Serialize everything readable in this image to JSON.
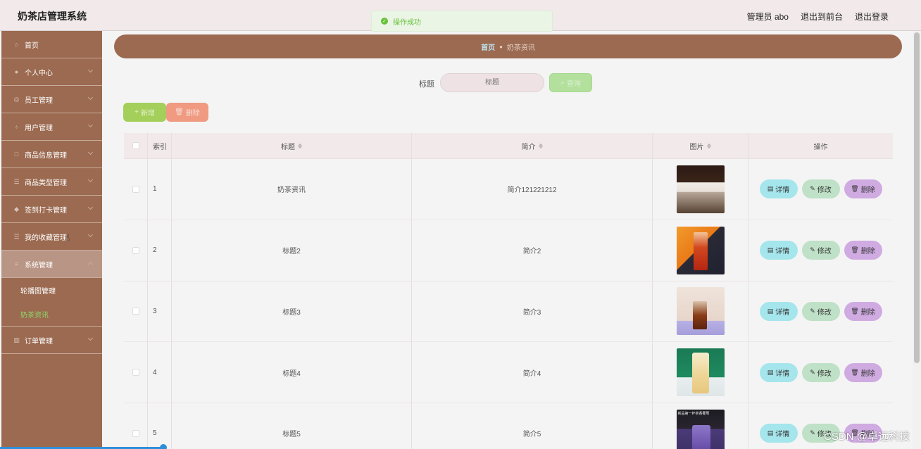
{
  "header": {
    "brand": "奶茶店管理系统",
    "user_label": "管理员 abo",
    "front_link": "退出到前台",
    "logout": "退出登录"
  },
  "toast": {
    "icon": "check-circle-icon",
    "text": "操作成功"
  },
  "sidebar": {
    "items": [
      {
        "label": "首页",
        "icon": "home-icon"
      },
      {
        "label": "个人中心",
        "icon": "user-icon"
      },
      {
        "label": "员工管理",
        "icon": "globe-icon"
      },
      {
        "label": "用户管理",
        "icon": "location-icon"
      },
      {
        "label": "商品信息管理",
        "icon": "box-icon"
      },
      {
        "label": "商品类型管理",
        "icon": "list-icon"
      },
      {
        "label": "签到打卡管理",
        "icon": "shield-icon"
      },
      {
        "label": "我的收藏管理",
        "icon": "list-icon"
      },
      {
        "label": "系统管理",
        "icon": "sliders-icon"
      },
      {
        "label": "订单管理",
        "icon": "chart-icon"
      }
    ],
    "sub_items": [
      {
        "label": "轮播图管理"
      },
      {
        "label": "奶茶资讯"
      }
    ]
  },
  "breadcrumb": {
    "home": "首页",
    "current": "奶茶资讯"
  },
  "search": {
    "label": "标题",
    "placeholder": "标题",
    "button": "查询"
  },
  "actions": {
    "add": "新增",
    "delete": "删除"
  },
  "table": {
    "headers": {
      "index": "索引",
      "title": "标题",
      "intro": "简介",
      "image": "图片",
      "ops": "操作"
    },
    "rows": [
      {
        "index": "1",
        "title": "奶茶资讯",
        "intro": "简介121221212"
      },
      {
        "index": "2",
        "title": "标题2",
        "intro": "简介2"
      },
      {
        "index": "3",
        "title": "标题3",
        "intro": "简介3"
      },
      {
        "index": "4",
        "title": "标题4",
        "intro": "简介4"
      },
      {
        "index": "5",
        "title": "标题5",
        "intro": "简介5"
      }
    ],
    "row_buttons": {
      "detail": "详情",
      "edit": "修改",
      "remove": "删除"
    },
    "thumb5_caption": "新品第一杯茶香葡萄"
  },
  "watermark": "CSDN @卓远科技",
  "colors": {
    "sidebar": "#9b6a50",
    "header": "#f1e9ea",
    "detail_btn": "#a5e5ec",
    "edit_btn": "#bfe1c7",
    "remove_btn": "#cfabe1",
    "add_btn": "#a4cf5b",
    "delete_btn": "#ef9a81"
  }
}
